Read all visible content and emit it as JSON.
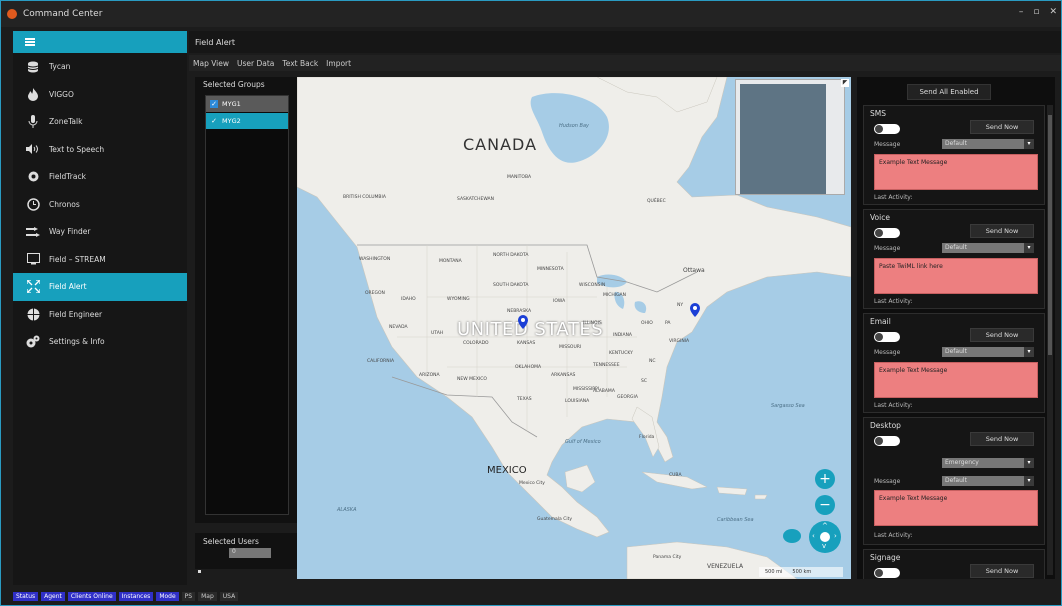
{
  "window": {
    "title": "Command Center",
    "controls": [
      "–",
      "▫",
      "✕"
    ]
  },
  "sidebar": {
    "menu_icon": "hamburger-icon",
    "items": [
      {
        "label": "Tycan",
        "icon": "database-icon"
      },
      {
        "label": "VIGGO",
        "icon": "fire-icon"
      },
      {
        "label": "ZoneTalk",
        "icon": "microphone-icon"
      },
      {
        "label": "Text to Speech",
        "icon": "speaker-icon"
      },
      {
        "label": "FieldTrack",
        "icon": "gear-icon"
      },
      {
        "label": "Chronos",
        "icon": "clock-icon"
      },
      {
        "label": "Way Finder",
        "icon": "route-icon"
      },
      {
        "label": "Field – STREAM",
        "icon": "screen-icon"
      },
      {
        "label": "Field Alert",
        "icon": "expand-icon",
        "active": true
      },
      {
        "label": "Field Engineer",
        "icon": "wheel-icon"
      },
      {
        "label": "Settings & Info",
        "icon": "cogs-icon"
      }
    ]
  },
  "main": {
    "header": "Field Alert",
    "tabs": [
      "Map View",
      "User Data",
      "Text Back",
      "Import"
    ]
  },
  "groups": {
    "title": "Selected Groups",
    "items": [
      "MYG1",
      "MYG2"
    ]
  },
  "users": {
    "title": "Selected Users",
    "value": "0"
  },
  "map": {
    "labels": {
      "canada": "CANADA",
      "us": "UNITED STATES",
      "mexico": "MEXICO",
      "alaska": "ALASKA",
      "manitoba": "MANITOBA",
      "quebec": "QUÉBEC",
      "sask": "SASKATCHEWAN",
      "bc": "BRITISH COLUMBIA",
      "washington": "WASHINGTON",
      "montana": "MONTANA",
      "nd": "NORTH DAKOTA",
      "mn": "MINNESOTA",
      "sd": "SOUTH DAKOTA",
      "wisconsin": "WISCONSIN",
      "michigan": "MICHIGAN",
      "oregon": "OREGON",
      "idaho": "IDAHO",
      "wyoming": "WYOMING",
      "iowa": "IOWA",
      "nebraska": "NEBRASKA",
      "nevada": "NEVADA",
      "utah": "UTAH",
      "colorado": "COLORADO",
      "kansas": "KANSAS",
      "missouri": "MISSOURI",
      "illinois": "ILLINOIS",
      "indiana": "INDIANA",
      "ohio": "OHIO",
      "pa": "PA",
      "ny": "NY",
      "ontario": "Ottawa",
      "virginia": "VIRGINIA",
      "kentucky": "KENTUCKY",
      "tennessee": "TENNESSEE",
      "nc": "NC",
      "california": "CALIFORNIA",
      "arizona": "ARIZONA",
      "nm": "NEW MEXICO",
      "oklahoma": "OKLAHOMA",
      "arkansas": "ARKANSAS",
      "texas": "TEXAS",
      "louisiana": "LOUISIANA",
      "mississippi": "MISSISSIPPI",
      "alabama": "ALABAMA",
      "georgia": "GEORGIA",
      "sc": "SC",
      "florida": "Florida",
      "hudson_bay": "Hudson Bay",
      "gulf": "Gulf of Mexico",
      "sargasso": "Sargasso Sea",
      "cuba": "CUBA",
      "mexico_city": "Mexico City",
      "guatemala": "Guatemala City",
      "panama": "Panama City",
      "venezuela": "VENEZUELA",
      "caribbean": "Caribbean Sea"
    },
    "scale_mi": "500 mi",
    "scale_km": "500 km"
  },
  "alerts": {
    "send_all_label": "Send All Enabled",
    "cards": [
      {
        "title": "SMS",
        "send_label": "Send Now",
        "message_label": "Message",
        "select_value": "Default",
        "text": "Example Text Message",
        "last_activity": "Last Activity:"
      },
      {
        "title": "Voice",
        "send_label": "Send Now",
        "message_label": "Message",
        "select_value": "Default",
        "text": "Paste TwiML link here",
        "last_activity": "Last Activity:"
      },
      {
        "title": "Email",
        "send_label": "Send Now",
        "message_label": "Message",
        "select_value": "Default",
        "text": "Example Text Message",
        "last_activity": "Last Activity:"
      },
      {
        "title": "Desktop",
        "send_label": "Send Now",
        "message_label": "Message",
        "select_value": "Default",
        "priority_value": "Emergency",
        "text": "Example Text Message",
        "last_activity": "Last Activity:"
      },
      {
        "title": "Signage",
        "send_label": "Send Now"
      }
    ]
  },
  "statusbar": {
    "tags": [
      "Status",
      "Agent",
      "Clients Online",
      "Instances",
      "Mode"
    ],
    "plain": [
      "PS",
      "Map",
      "USA"
    ]
  },
  "colors": {
    "accent": "#17a0bd",
    "message_bg": "#ed7f80",
    "status_tag": "#3030c8"
  }
}
